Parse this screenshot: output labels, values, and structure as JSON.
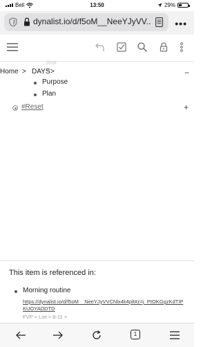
{
  "status_bar": {
    "carrier": "Bell",
    "time": "13:50",
    "battery": "29%",
    "battery_level": 0.29
  },
  "browser": {
    "url": "dynalist.io/d/f5oM__NeeYJyVV..."
  },
  "breadcrumb": {
    "home": "Home",
    "separator": ">",
    "current": "DAYS",
    "separator2": ">"
  },
  "ghost_items": [
    "...time",
    "...al"
  ],
  "outline": {
    "items": [
      {
        "label": "Purpose"
      },
      {
        "label": "Plan"
      }
    ],
    "reset_link": "#Reset",
    "collapse_symbol": "−",
    "add_symbol": "+"
  },
  "referenced": {
    "title": "This item is referenced in:",
    "item_name": "Morning routine",
    "item_link": "https://dynalist.io/d/f5oM__NeeYJyVVCNlx4k4plt#z=j_PtOKGgzKdTIPKUOYADDTD",
    "crumbs": [
      "FVP",
      ">",
      "List",
      ">",
      "8-11",
      ">"
    ]
  },
  "bottom_bar": {
    "tab_count": "1"
  },
  "icons": {
    "menu": "hamburger-menu-icon",
    "undo": "undo-icon",
    "checklist": "checklist-icon",
    "search": "search-icon",
    "lock": "lock-icon",
    "more": "more-vertical-icon"
  }
}
